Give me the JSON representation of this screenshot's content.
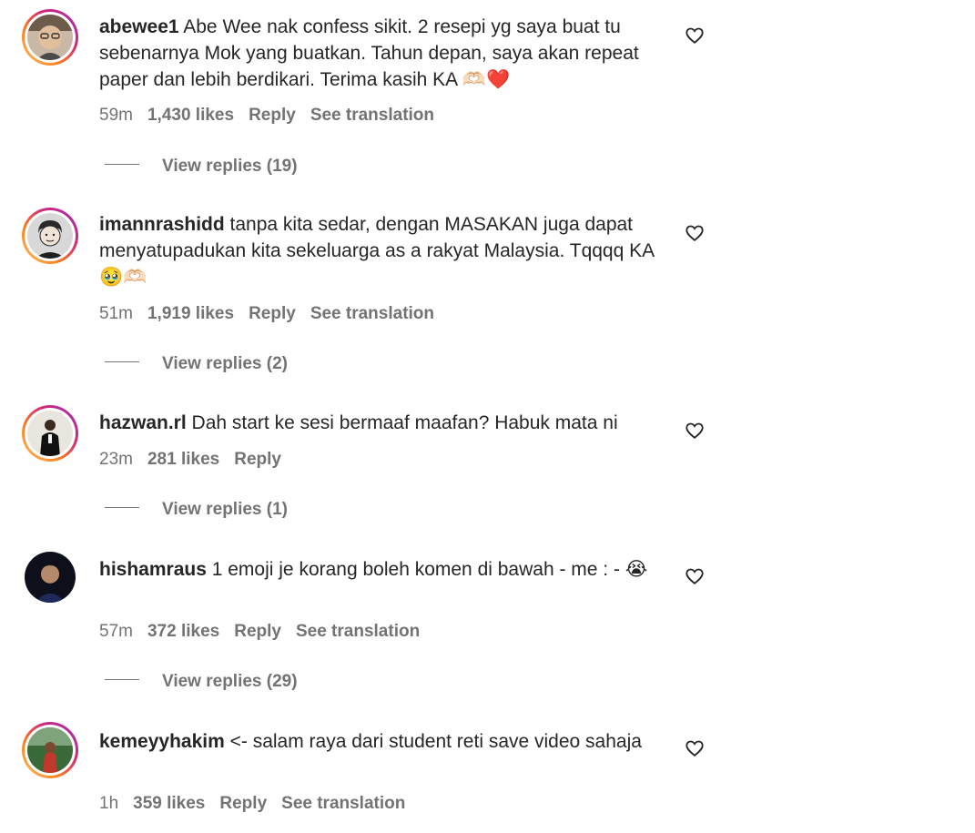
{
  "comments": [
    {
      "username": "abewee1",
      "text": "Abe Wee nak confess sikit. 2 resepi yg saya buat tu sebenarnya Mok yang buatkan. Tahun depan, saya akan repeat paper dan lebih berdikari. Terima kasih KA 🫶🏻❤️",
      "time": "59m",
      "likes": "1,430 likes",
      "reply_label": "Reply",
      "translation_label": "See translation",
      "view_replies": "View replies (19)",
      "avatar_icon": "user-avatar",
      "like_icon": "heart-outline-icon"
    },
    {
      "username": "imannrashidd",
      "text": "tanpa kita sedar, dengan MASAKAN juga dapat menyatupadukan kita sekeluarga as a rakyat Malaysia. Tqqqq KA🥹🫶🏻",
      "time": "51m",
      "likes": "1,919 likes",
      "reply_label": "Reply",
      "translation_label": "See translation",
      "view_replies": "View replies (2)",
      "avatar_icon": "user-avatar",
      "like_icon": "heart-outline-icon"
    },
    {
      "username": "hazwan.rl",
      "text": "Dah start ke sesi bermaaf maafan? Habuk mata ni",
      "time": "23m",
      "likes": "281 likes",
      "reply_label": "Reply",
      "view_replies": "View replies (1)",
      "avatar_icon": "user-avatar",
      "like_icon": "heart-outline-icon"
    },
    {
      "username": "hishamraus",
      "text": "1 emoji je korang boleh komen di bawah - me : - 😭",
      "time": "57m",
      "likes": "372 likes",
      "reply_label": "Reply",
      "translation_label": "See translation",
      "view_replies": "View replies (29)",
      "avatar_icon": "user-avatar",
      "like_icon": "heart-outline-icon"
    },
    {
      "username": "kemeyyhakim",
      "text": "<- salam raya dari student reti save video sahaja",
      "time": "1h",
      "likes": "359 likes",
      "reply_label": "Reply",
      "translation_label": "See translation",
      "avatar_icon": "user-avatar",
      "like_icon": "heart-outline-icon"
    }
  ],
  "colors": {
    "text": "#262626",
    "secondary": "#737373",
    "story_ring_start": "#fdc468",
    "story_ring_end": "#962fbf"
  }
}
